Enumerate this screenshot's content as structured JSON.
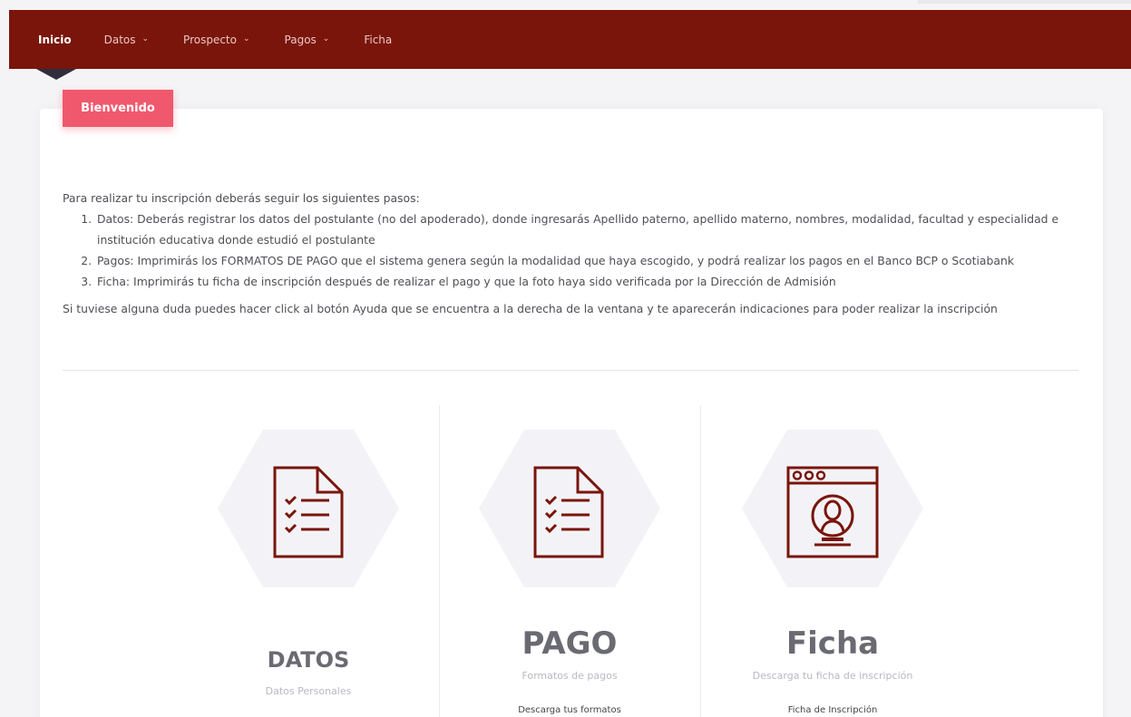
{
  "nav": {
    "items": [
      {
        "label": "Inicio",
        "active": true,
        "dropdown": false
      },
      {
        "label": "Datos",
        "active": false,
        "dropdown": true
      },
      {
        "label": "Prospecto",
        "active": false,
        "dropdown": true
      },
      {
        "label": "Pagos",
        "active": false,
        "dropdown": true
      },
      {
        "label": "Ficha",
        "active": false,
        "dropdown": false
      }
    ],
    "chevron": "⌄"
  },
  "welcome": {
    "label": "Bienvenido"
  },
  "instructions": {
    "intro": "Para realizar tu inscripción deberás seguir los siguientes pasos:",
    "steps": [
      "Datos: Deberás registrar los datos del postulante (no del apoderado), donde ingresarás Apellido paterno, apellido materno, nombres, modalidad, facultad y especialidad e institución educativa donde estudió el postulante",
      "Pagos: Imprimirás los FORMATOS DE PAGO que el sistema genera según la modalidad que haya escogido, y podrá realizar los pagos en el Banco BCP o Scotiabank",
      "Ficha: Imprimirás tu ficha de inscripción después de realizar el pago y que la foto haya sido verificada por la Dirección de Admisión"
    ],
    "note": "Si tuviese alguna duda puedes hacer click al botón Ayuda que se encuentra a la derecha de la ventana y te aparecerán indicaciones para poder realizar la inscripción"
  },
  "features": [
    {
      "title": "DATOS",
      "subtitle": "Datos Personales",
      "link": "",
      "icon": "checklist-document-icon"
    },
    {
      "title": "PAGO",
      "subtitle": "Formatos de pagos",
      "link": "Descarga tus formatos",
      "icon": "checklist-document-icon"
    },
    {
      "title": "Ficha",
      "subtitle": "Descarga tu ficha de inscripción",
      "link": "Ficha de Inscripción",
      "icon": "profile-window-icon"
    }
  ],
  "colors": {
    "navbar": "#7a150b",
    "welcome_button": "#f0586d",
    "icon_stroke": "#7a150b",
    "hexagon": "#f3f3f7"
  }
}
